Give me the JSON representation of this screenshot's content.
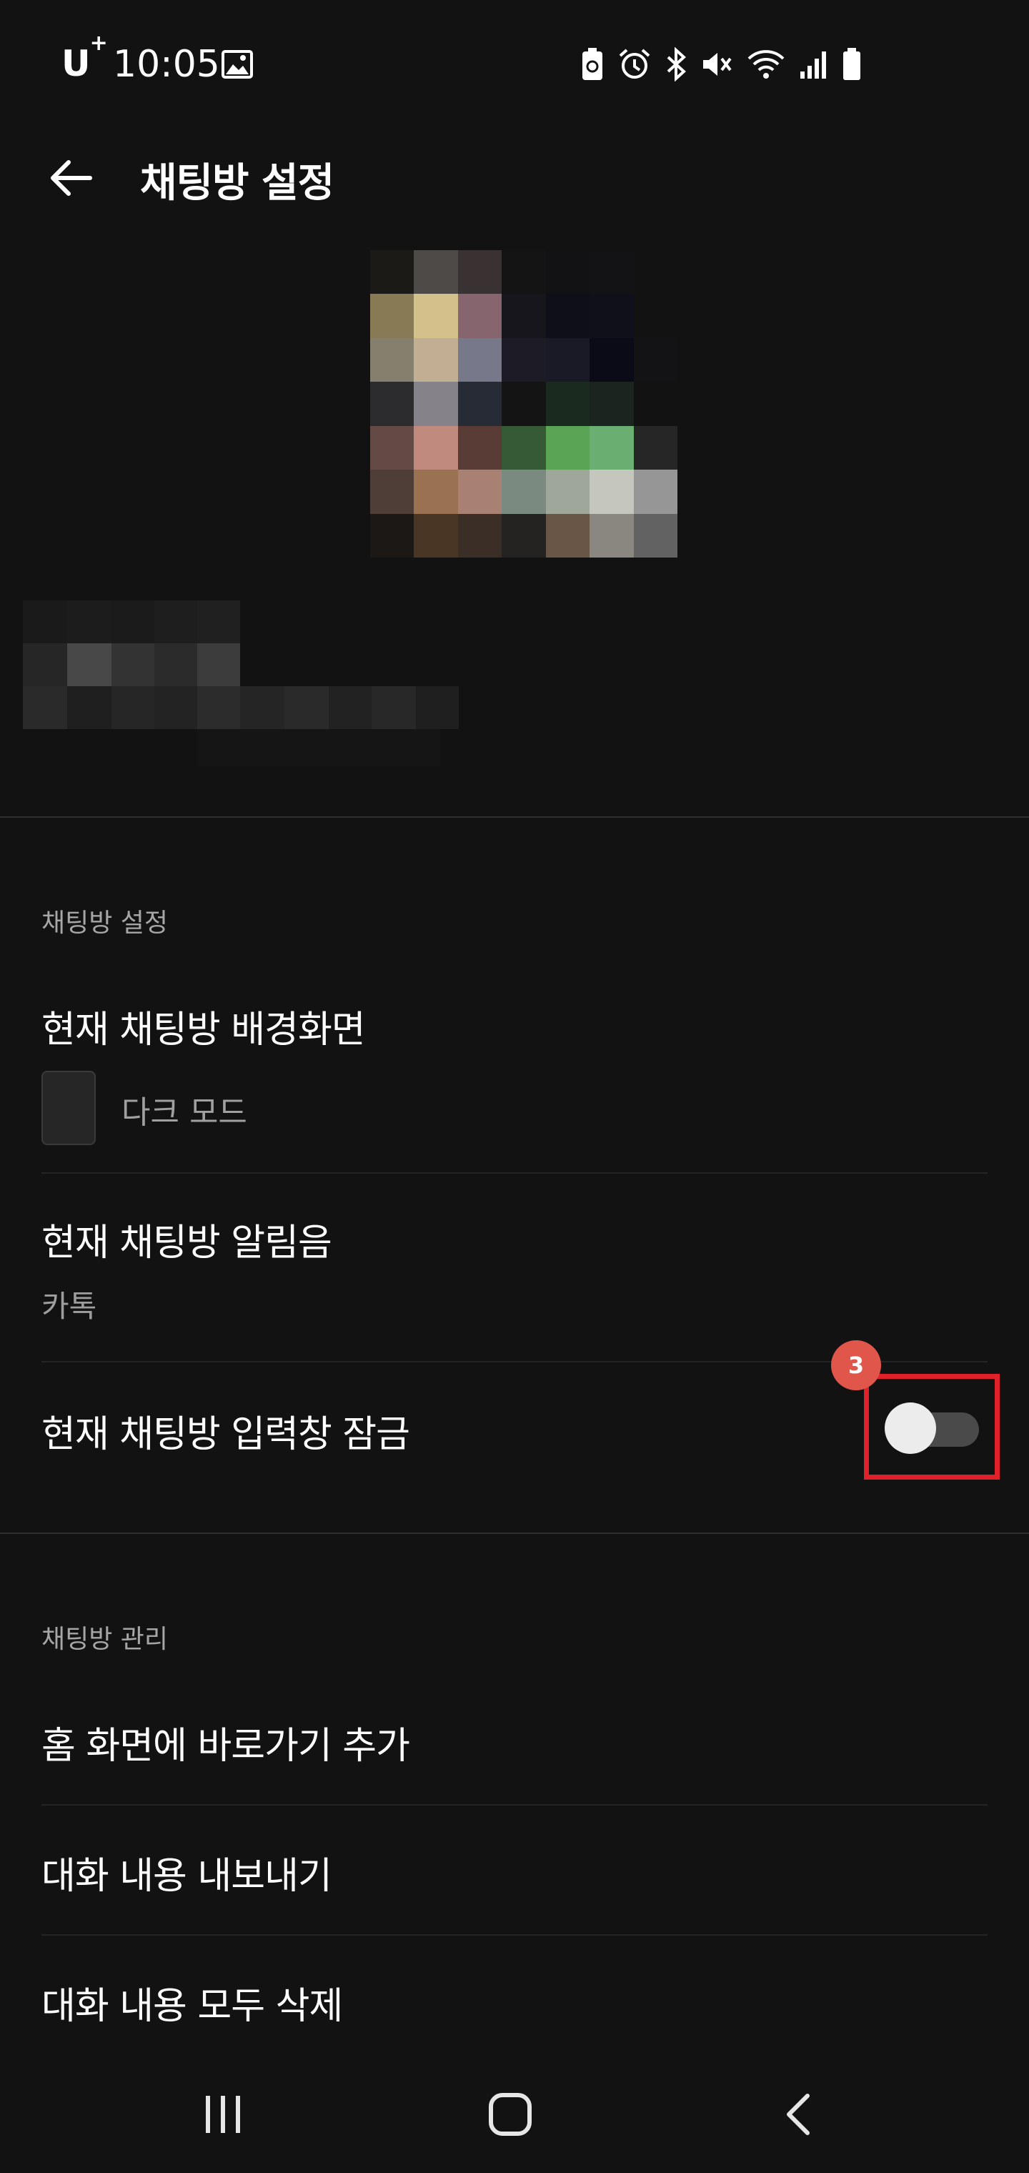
{
  "status_bar": {
    "carrier": "U",
    "carrier_plus": "+",
    "time": "10:05"
  },
  "app_bar": {
    "title": "채팅방 설정"
  },
  "chat_settings": {
    "section_label": "채팅방 설정",
    "wallpaper": {
      "title": "현재 채팅방 배경화면",
      "value": "다크 모드"
    },
    "notification_sound": {
      "title": "현재 채팅방 알림음",
      "value": "카톡"
    },
    "input_lock": {
      "title": "현재 채팅방 입력창 잠금",
      "enabled": false
    }
  },
  "chat_management": {
    "section_label": "채팅방 관리",
    "items": [
      {
        "label": "홈 화면에 바로가기 추가"
      },
      {
        "label": "대화 내용 내보내기"
      },
      {
        "label": "대화 내용 모두 삭제"
      }
    ]
  },
  "annotation": {
    "step_number": "3",
    "highlight_color": "#e0212a",
    "badge_color": "#e0564a"
  },
  "icons": [
    "back-arrow-icon",
    "gallery-icon",
    "battery-saver-icon",
    "alarm-icon",
    "bluetooth-icon",
    "mute-icon",
    "wifi-icon",
    "signal-icon",
    "battery-icon",
    "recent-apps-icon",
    "home-icon",
    "nav-back-icon"
  ]
}
